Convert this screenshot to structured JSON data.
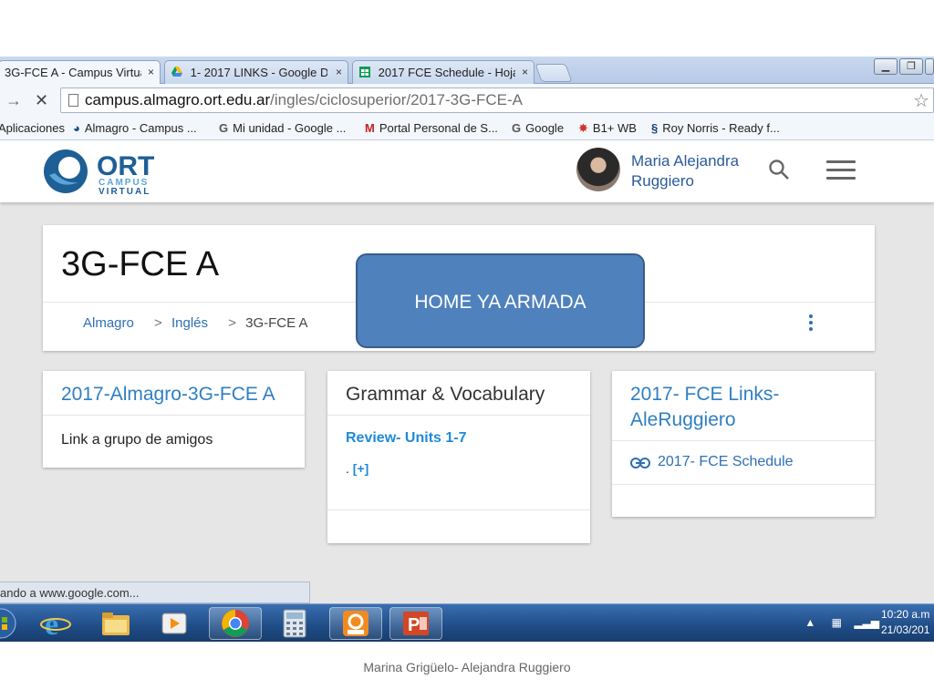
{
  "browser": {
    "tabs": [
      {
        "label": "3G-FCE A - Campus Virtua",
        "active": true
      },
      {
        "label": "1- 2017 LINKS - Google Dr",
        "active": false
      },
      {
        "label": "2017 FCE Schedule - Hoja",
        "active": false
      }
    ],
    "tab_close": "×",
    "url_domain": "campus.almagro.ort.edu.ar",
    "url_path": "/ingles/ciclosuperior/2017-3G-FCE-A",
    "bookmarks": [
      {
        "label": "Aplicaciones",
        "icon": "apps-icon"
      },
      {
        "label": "Almagro - Campus ...",
        "icon": "ort-favicon"
      },
      {
        "label": "Mi unidad - Google ...",
        "icon": "google-icon"
      },
      {
        "label": "Portal Personal de S...",
        "icon": "gmail-icon"
      },
      {
        "label": "Google",
        "icon": "google-icon"
      },
      {
        "label": "B1+ WB",
        "icon": "bookmark-icon"
      },
      {
        "label": "Roy Norris - Ready f...",
        "icon": "bookmark-icon"
      }
    ],
    "status_text": "ando a www.google.com..."
  },
  "site": {
    "user_name_line1": "Maria Alejandra",
    "user_name_line2": "Ruggiero",
    "logo_text": "ORT",
    "logo_sub1": "CAMPUS",
    "logo_sub2": "VIRTUAL"
  },
  "course": {
    "title": "3G-FCE A",
    "breadcrumb": [
      "Almagro",
      "Inglés",
      "3G-FCE A"
    ],
    "breadcrumb_sep": ">"
  },
  "callout": {
    "text": "HOME YA ARMADA"
  },
  "cards": [
    {
      "title": "2017-Almagro-3G-FCE A",
      "items": [
        "Link a grupo de amigos"
      ]
    },
    {
      "title": "Grammar & Vocabulary",
      "link": "Review- Units 1-7",
      "more_prefix": ".",
      "more": "[+]"
    },
    {
      "title": "2017- FCE Links-AleRuggiero",
      "link": "2017- FCE Schedule"
    }
  ],
  "taskbar": {
    "time": "10:20 a.m",
    "date": "21/03/201"
  },
  "footer": {
    "text": "Marina Grigüelo- Alejandra Ruggiero"
  },
  "colors": {
    "accent_blue": "#2f7fc1",
    "callout_fill": "#4f81bd",
    "taskbar": "#1f4c86"
  }
}
